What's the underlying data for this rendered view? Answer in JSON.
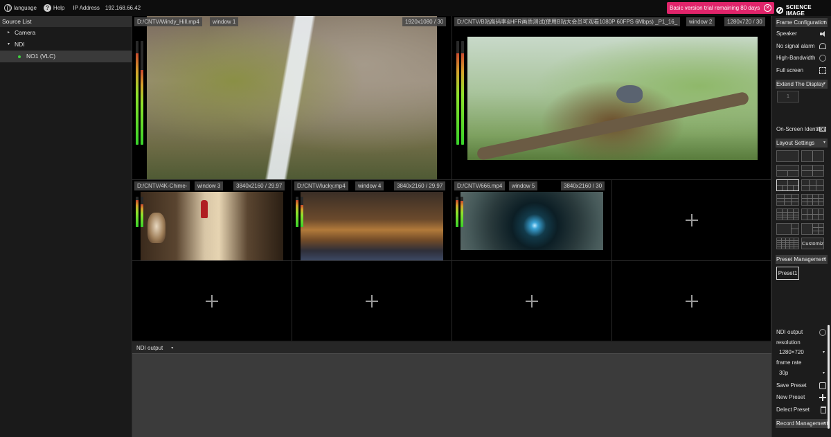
{
  "topbar": {
    "language_label": "language",
    "help_label": "Help",
    "ip_label": "IP Address",
    "ip_value": "192.168.66.42",
    "trial_text": "Basic version trial remaining 80 days",
    "close_glyph": "✕",
    "logo_text": "SCIENCE IMAGE",
    "accent_color": "#e0246a"
  },
  "source_list": {
    "title": "Source List",
    "items": [
      {
        "label": "Camera",
        "caret": "▸"
      },
      {
        "label": "NDI",
        "caret": "▾"
      },
      {
        "label": "NO1 (VLC)",
        "status_color": "#3fd13f"
      }
    ]
  },
  "grid": {
    "windows": [
      {
        "path": "D:/CNTV/Windy_Hill.mp4",
        "name": "window 1",
        "res": "1920x1080 / 30",
        "audio_levels": [
          0.88,
          0.72
        ]
      },
      {
        "path": "D:/CNTV/B站高码率&HFR画质测试(使用B站大会员可观看1080P 60FPS 6Mbps) _P1_16_",
        "name": "window 2",
        "res": "1280x720 / 30",
        "audio_levels": [
          0.88,
          0.88
        ]
      },
      {
        "path": "D:/CNTV/4K-Chime-",
        "name": "window 3",
        "res": "3840x2160 / 29.97",
        "audio_levels": [
          0.88,
          0.74
        ]
      },
      {
        "path": "D:/CNTV/lucky.mp4",
        "name": "window 4",
        "res": "3840x2160 / 29.97",
        "audio_levels": [
          0.88,
          0.72
        ]
      },
      {
        "path": "D:/CNTV/666.mp4",
        "name": "window 5",
        "res": "3840x2160 / 30",
        "audio_levels": [
          0.88,
          0.86
        ]
      }
    ]
  },
  "ndi_output": {
    "label": "NDI output",
    "chevron": "▾"
  },
  "right_panel": {
    "frame_config_title": "Frame Configuration",
    "speaker_label": "Speaker",
    "no_signal_label": "No signal alarm",
    "high_bandwidth_label": "High-Bandwidth",
    "full_screen_label": "Full screen",
    "extend_title": "Extend The Display",
    "extend_value": "1",
    "on_screen_label": "On-Screen Identification",
    "layout_title": "Layout Settings",
    "custom_label": "Customize",
    "preset_title": "Preset Management",
    "preset_button": "Preset1",
    "ndi_output_label": "NDI output",
    "resolution_label": "resolution",
    "resolution_value": "1280×720",
    "frame_rate_label": "frame rate",
    "frame_rate_value": "30p",
    "save_preset_label": "Save Preset",
    "new_preset_label": "New Preset",
    "delete_preset_label": "Delect Preset",
    "record_title": "Record Management",
    "chevron": "▾"
  },
  "icons": {
    "language": "globe-icon",
    "help": "help-icon",
    "close": "close-icon",
    "logo": "science-image-logo",
    "speaker": "speaker-icon",
    "bell": "bell-icon",
    "toggle": "toggle-circle-icon",
    "fullscreen": "fullscreen-icon",
    "monitor": "monitor-icon",
    "save": "save-icon",
    "plus": "plus-icon",
    "trash": "trash-icon",
    "add_source": "add-source-plus-icon"
  }
}
